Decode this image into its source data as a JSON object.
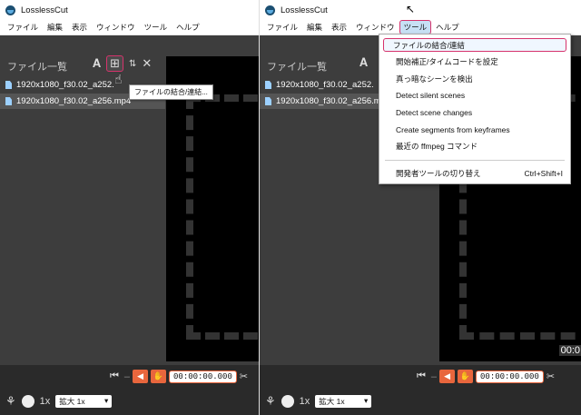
{
  "app": {
    "title": "LosslessCut"
  },
  "menu": [
    "ファイル",
    "編集",
    "表示",
    "ウィンドウ",
    "ツール",
    "ヘルプ"
  ],
  "file_list": {
    "header": "ファイル一覧",
    "files": [
      "1920x1080_f30.02_a252.mp4",
      "1920x1080_f30.02_a256.mp4"
    ],
    "files_truncated": [
      "1920x1080_f30.02_a252.",
      "1920x1080_f30.02_a256.mp4"
    ]
  },
  "tooltip": "ファイルの結合/連結...",
  "controls": {
    "timecode": "00:00:00.000",
    "right_timecode_partial": "00:0"
  },
  "bottom": {
    "zoom_multiplier": "1x",
    "zoom_select": "拡大 1x"
  },
  "tools_menu": {
    "items": [
      "ファイルの結合/連結",
      "開始補正/タイムコードを設定",
      "真っ暗なシーンを検出",
      "Detect silent scenes",
      "Detect scene changes",
      "Create segments from keyframes",
      "最近の ffmpeg コマンド"
    ],
    "devtools": {
      "label": "開発者ツールの切り替え",
      "shortcut": "Ctrl+Shift+I"
    }
  },
  "colors": {
    "highlight": "#d6336c",
    "accent": "#e8663d"
  }
}
